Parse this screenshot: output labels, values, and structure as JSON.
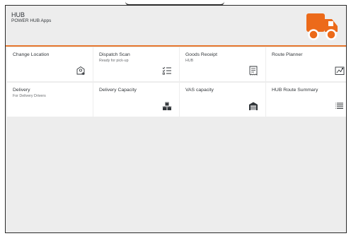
{
  "header": {
    "title": "HUB",
    "subtitle": "POWER HUB Apps",
    "logo_icon": "truck-icon",
    "accent_color": "#e6772e"
  },
  "tiles": [
    {
      "title": "Change Location",
      "subtitle": "",
      "icon": "location-add-icon"
    },
    {
      "title": "Dispatch Scan",
      "subtitle": "Ready for pick-up",
      "icon": "checklist-icon"
    },
    {
      "title": "Goods Receipt",
      "subtitle": "HUB",
      "icon": "receipt-icon"
    },
    {
      "title": "Route Planner",
      "subtitle": "",
      "icon": "map-icon"
    },
    {
      "title": "Delivery",
      "subtitle": "For Delivery Drivers",
      "icon": ""
    },
    {
      "title": "Delivery Capacity",
      "subtitle": "",
      "icon": "boxes-icon"
    },
    {
      "title": "VAS capacity",
      "subtitle": "",
      "icon": "warehouse-icon"
    },
    {
      "title": "HUB Route Summary",
      "subtitle": "",
      "icon": "list-icon"
    }
  ]
}
